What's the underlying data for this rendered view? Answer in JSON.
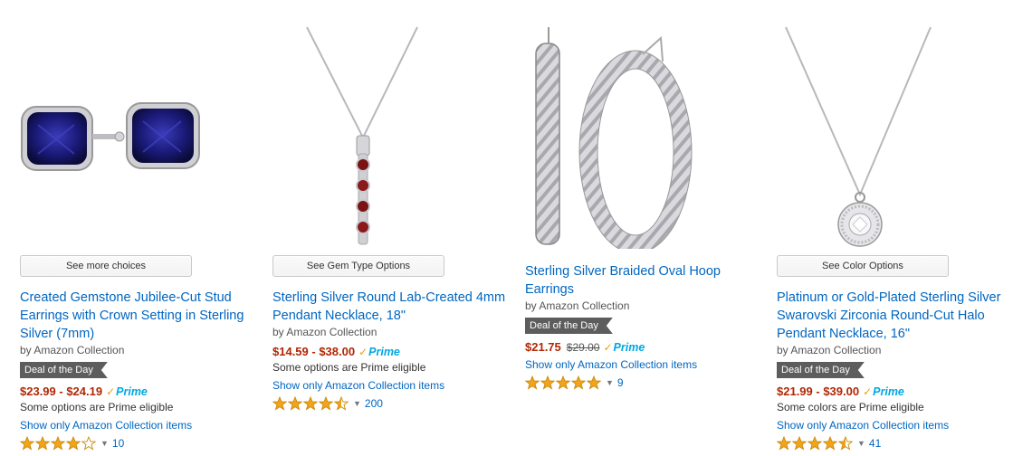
{
  "products": [
    {
      "option_button": "See more choices",
      "title": "Created Gemstone Jubilee-Cut Stud Earrings with Crown Setting in Sterling Silver (7mm)",
      "byline": "by Amazon Collection",
      "deal_badge": "Deal of the Day",
      "price": "$23.99 - $24.19",
      "was_price": "",
      "prime_label": "Prime",
      "note": "Some options are Prime eligible",
      "collection_link": "Show only Amazon Collection items",
      "rating": 4.0,
      "review_count": "10",
      "image_icon": "sapphire-stud-earrings-image"
    },
    {
      "option_button": "See Gem Type Options",
      "title": "Sterling Silver Round Lab-Created 4mm Pendant Necklace, 18\"",
      "byline": "by Amazon Collection",
      "deal_badge": "",
      "price": "$14.59 - $38.00",
      "was_price": "",
      "prime_label": "Prime",
      "note": "Some options are Prime eligible",
      "collection_link": "Show only Amazon Collection items",
      "rating": 4.5,
      "review_count": "200",
      "image_icon": "garnet-pendant-necklace-image"
    },
    {
      "option_button": "",
      "title": "Sterling Silver Braided Oval Hoop Earrings",
      "byline": "by Amazon Collection",
      "deal_badge": "Deal of the Day",
      "price": "$21.75",
      "was_price": "$29.00",
      "prime_label": "Prime",
      "note": "",
      "collection_link": "Show only Amazon Collection items",
      "rating": 5.0,
      "review_count": "9",
      "image_icon": "braided-hoop-earrings-image"
    },
    {
      "option_button": "See Color Options",
      "title": "Platinum or Gold-Plated Sterling Silver Swarovski Zirconia Round-Cut Halo Pendant Necklace, 16\"",
      "byline": "by Amazon Collection",
      "deal_badge": "Deal of the Day",
      "price": "$21.99 - $39.00",
      "was_price": "",
      "prime_label": "Prime",
      "note": "Some colors are Prime eligible",
      "collection_link": "Show only Amazon Collection items",
      "rating": 4.5,
      "review_count": "41",
      "image_icon": "halo-pendant-necklace-image"
    }
  ],
  "colors": {
    "link": "#0066c0",
    "price": "#b12704",
    "star": "#f4a41c",
    "prime": "#00a8e1"
  }
}
